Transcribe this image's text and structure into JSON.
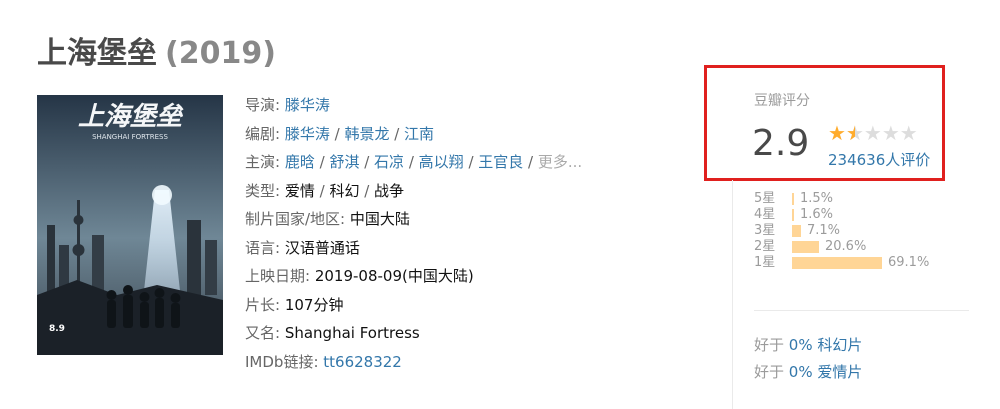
{
  "movie": {
    "title": "上海堡垒",
    "year": "(2019)"
  },
  "poster": {
    "title_art": "上海堡垒",
    "subtitle_art": "SHANGHAI FORTRESS",
    "date_art": "8.9",
    "colors": {
      "sky_top": "#253546",
      "sky_bottom": "#6f8796",
      "beam": "#cfe8ff",
      "ground": "#1b2128"
    }
  },
  "info": {
    "director_label": "导演: ",
    "director": "滕华涛",
    "writer_label": "编剧: ",
    "writers": [
      "滕华涛",
      "韩景龙",
      "江南"
    ],
    "cast_label": "主演: ",
    "cast": [
      "鹿晗",
      "舒淇",
      "石凉",
      "高以翔",
      "王官良"
    ],
    "more": "更多...",
    "genre_label": "类型: ",
    "genres": [
      "爱情",
      "科幻",
      "战争"
    ],
    "country_label": "制片国家/地区: ",
    "country": "中国大陆",
    "language_label": "语言: ",
    "language": "汉语普通话",
    "release_label": "上映日期: ",
    "release": "2019-08-09(中国大陆)",
    "runtime_label": "片长: ",
    "runtime": "107分钟",
    "aka_label": "又名: ",
    "aka": "Shanghai Fortress",
    "imdb_label": "IMDb链接: ",
    "imdb": "tt6628322",
    "separator": " / "
  },
  "rating": {
    "label": "豆瓣评分",
    "score": "2.9",
    "stars": {
      "full": 1,
      "half": 1,
      "empty": 3
    },
    "votes": "234636人评价",
    "distribution": [
      {
        "label": "5星",
        "pct_text": "1.5%",
        "value": 1.5
      },
      {
        "label": "4星",
        "pct_text": "1.6%",
        "value": 1.6
      },
      {
        "label": "3星",
        "pct_text": "7.1%",
        "value": 7.1
      },
      {
        "label": "2星",
        "pct_text": "20.6%",
        "value": 20.6
      },
      {
        "label": "1星",
        "pct_text": "69.1%",
        "value": 69.1
      }
    ],
    "highlight_color": "#e0201e"
  },
  "better_than": [
    {
      "prefix": "好于 ",
      "pct": "0%",
      "genre": " 科幻片"
    },
    {
      "prefix": "好于 ",
      "pct": "0%",
      "genre": " 爱情片"
    }
  ],
  "colors": {
    "link": "#37a",
    "bar": "#ffd596",
    "star": "#ffac2d"
  }
}
